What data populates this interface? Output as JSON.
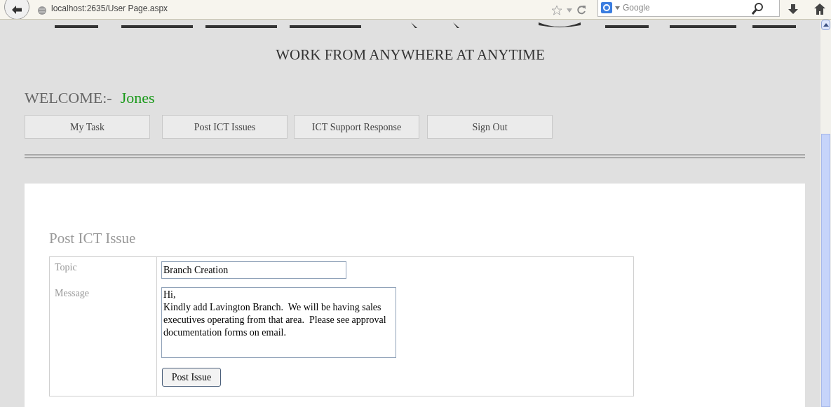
{
  "browser": {
    "url": "localhost:2635/User Page.aspx",
    "search_placeholder": "Google"
  },
  "page": {
    "tagline": "WORK FROM ANYWHERE AT ANYTIME",
    "welcome_label": "WELCOME:-",
    "user_name": "Jones",
    "nav": [
      {
        "label": "My Task"
      },
      {
        "label": "Post ICT Issues"
      },
      {
        "label": "ICT Support Response"
      },
      {
        "label": "Sign Out"
      }
    ]
  },
  "form": {
    "title": "Post ICT Issue",
    "fields": [
      {
        "kind": "input",
        "label": "Topic",
        "value": "Branch Creation"
      },
      {
        "kind": "textarea",
        "label": "Message",
        "value": "Hi,\nKindly add Lavington Branch.  We will be having sales executives operating from that area.  Please see approval documentation forms on email."
      }
    ],
    "submit": "Post Issue"
  }
}
